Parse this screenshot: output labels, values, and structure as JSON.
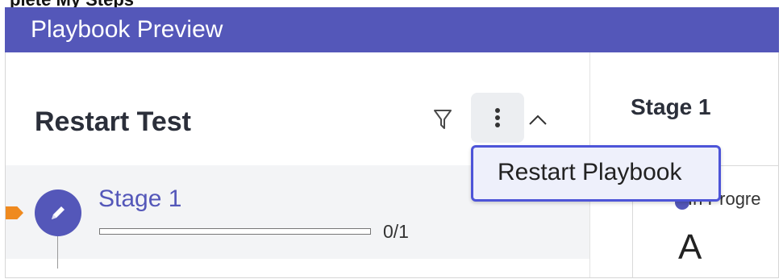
{
  "top_crop_text": "plete My Steps",
  "header": {
    "title": "Playbook Preview"
  },
  "playbook": {
    "title": "Restart Test"
  },
  "toolbar": {
    "filter_icon": "filter-icon",
    "more_icon": "vertical-ellipsis-icon",
    "collapse_icon": "chevron-up-icon"
  },
  "menu": {
    "items": [
      {
        "label": "Restart Playbook"
      }
    ]
  },
  "stage": {
    "label": "Stage 1",
    "icon": "pencil-icon",
    "progress_text": "0/1",
    "progress_value": 0
  },
  "right_panel": {
    "stage_header": "Stage 1",
    "card_status": "In Progre",
    "card_letter": "A"
  },
  "colors": {
    "header_bg": "#5457b9",
    "accent": "#5457b9",
    "marker": "#ef8a1f",
    "menu_border": "#4d54d8"
  }
}
